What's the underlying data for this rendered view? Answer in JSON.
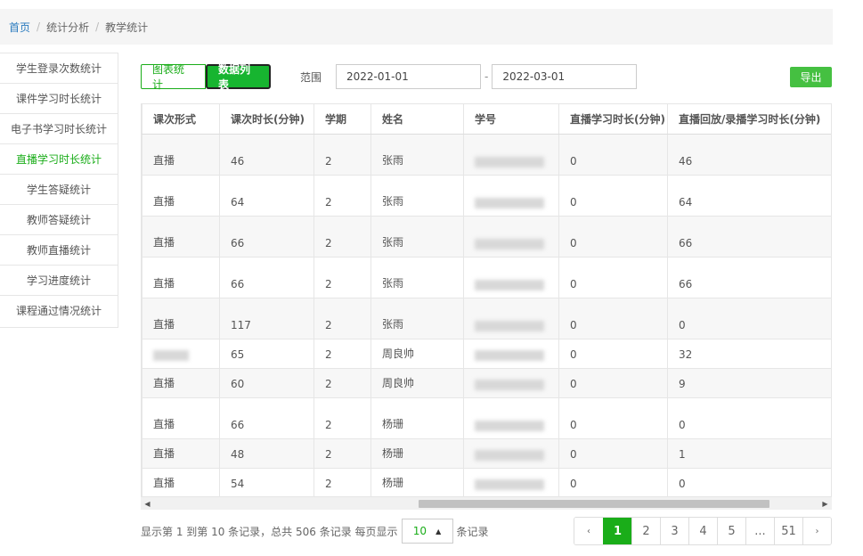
{
  "breadcrumb": {
    "home": "首页",
    "level2": "统计分析",
    "level3": "教学统计"
  },
  "sidebar": {
    "items": [
      {
        "label": "学生登录次数统计",
        "active": false
      },
      {
        "label": "课件学习时长统计",
        "active": false
      },
      {
        "label": "电子书学习时长统计",
        "active": false
      },
      {
        "label": "直播学习时长统计",
        "active": true
      },
      {
        "label": "学生答疑统计",
        "active": false
      },
      {
        "label": "教师答疑统计",
        "active": false
      },
      {
        "label": "教师直播统计",
        "active": false
      },
      {
        "label": "学习进度统计",
        "active": false
      },
      {
        "label": "课程通过情况统计",
        "active": false
      }
    ]
  },
  "toolbar": {
    "chart_tab": "图表统计",
    "list_tab": "数据列表",
    "range_label": "范围",
    "start_date": "2022-01-01",
    "end_date": "2022-03-01",
    "dash": "-",
    "export_label": "导出"
  },
  "table": {
    "headers": [
      "课次形式",
      "课次时长(分钟)",
      "学期",
      "姓名",
      "学号",
      "直播学习时长(分钟)",
      "直播回放/录播学习时长(分钟)"
    ],
    "rows": [
      {
        "form": "直播",
        "duration": "46",
        "term": "2",
        "name": "张雨",
        "live": "0",
        "replay": "46"
      },
      {
        "form": "直播",
        "duration": "64",
        "term": "2",
        "name": "张雨",
        "live": "0",
        "replay": "64"
      },
      {
        "form": "直播",
        "duration": "66",
        "term": "2",
        "name": "张雨",
        "live": "0",
        "replay": "66"
      },
      {
        "form": "直播",
        "duration": "66",
        "term": "2",
        "name": "张雨",
        "live": "0",
        "replay": "66"
      },
      {
        "form": "直播",
        "duration": "117",
        "term": "2",
        "name": "张雨",
        "live": "0",
        "replay": "0"
      },
      {
        "form": "",
        "duration": "65",
        "term": "2",
        "name": "周良帅",
        "live": "0",
        "replay": "32"
      },
      {
        "form": "直播",
        "duration": "60",
        "term": "2",
        "name": "周良帅",
        "live": "0",
        "replay": "9"
      },
      {
        "form": "直播",
        "duration": "66",
        "term": "2",
        "name": "杨珊",
        "live": "0",
        "replay": "0"
      },
      {
        "form": "直播",
        "duration": "48",
        "term": "2",
        "name": "杨珊",
        "live": "0",
        "replay": "1"
      },
      {
        "form": "直播",
        "duration": "54",
        "term": "2",
        "name": "杨珊",
        "live": "0",
        "replay": "0"
      }
    ]
  },
  "footer": {
    "info_prefix": "显示第 1 到第 10 条记录，总共 506 条记录 每页显示",
    "page_size": "10",
    "info_suffix": "条记录"
  },
  "pagination": {
    "prev": "‹",
    "pages": [
      "1",
      "2",
      "3",
      "4",
      "5",
      "...",
      "51"
    ],
    "next": "›",
    "current": "1"
  },
  "colors": {
    "accent": "#1aad19",
    "export": "#45c041",
    "link": "#2a7bbf"
  }
}
